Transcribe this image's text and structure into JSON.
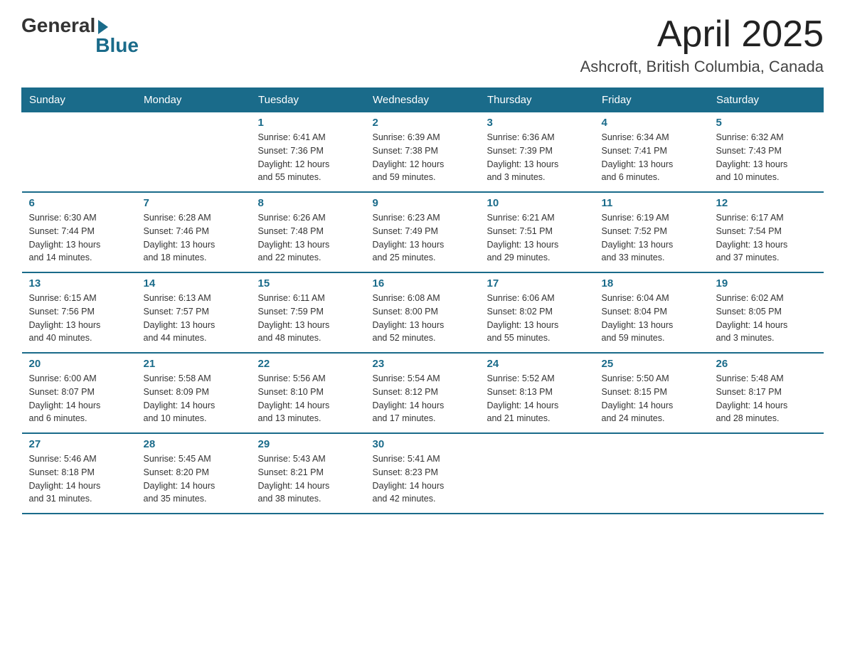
{
  "logo": {
    "general": "General",
    "blue": "Blue"
  },
  "header": {
    "month": "April 2025",
    "location": "Ashcroft, British Columbia, Canada"
  },
  "days_of_week": [
    "Sunday",
    "Monday",
    "Tuesday",
    "Wednesday",
    "Thursday",
    "Friday",
    "Saturday"
  ],
  "weeks": [
    [
      {
        "day": "",
        "info": ""
      },
      {
        "day": "",
        "info": ""
      },
      {
        "day": "1",
        "info": "Sunrise: 6:41 AM\nSunset: 7:36 PM\nDaylight: 12 hours\nand 55 minutes."
      },
      {
        "day": "2",
        "info": "Sunrise: 6:39 AM\nSunset: 7:38 PM\nDaylight: 12 hours\nand 59 minutes."
      },
      {
        "day": "3",
        "info": "Sunrise: 6:36 AM\nSunset: 7:39 PM\nDaylight: 13 hours\nand 3 minutes."
      },
      {
        "day": "4",
        "info": "Sunrise: 6:34 AM\nSunset: 7:41 PM\nDaylight: 13 hours\nand 6 minutes."
      },
      {
        "day": "5",
        "info": "Sunrise: 6:32 AM\nSunset: 7:43 PM\nDaylight: 13 hours\nand 10 minutes."
      }
    ],
    [
      {
        "day": "6",
        "info": "Sunrise: 6:30 AM\nSunset: 7:44 PM\nDaylight: 13 hours\nand 14 minutes."
      },
      {
        "day": "7",
        "info": "Sunrise: 6:28 AM\nSunset: 7:46 PM\nDaylight: 13 hours\nand 18 minutes."
      },
      {
        "day": "8",
        "info": "Sunrise: 6:26 AM\nSunset: 7:48 PM\nDaylight: 13 hours\nand 22 minutes."
      },
      {
        "day": "9",
        "info": "Sunrise: 6:23 AM\nSunset: 7:49 PM\nDaylight: 13 hours\nand 25 minutes."
      },
      {
        "day": "10",
        "info": "Sunrise: 6:21 AM\nSunset: 7:51 PM\nDaylight: 13 hours\nand 29 minutes."
      },
      {
        "day": "11",
        "info": "Sunrise: 6:19 AM\nSunset: 7:52 PM\nDaylight: 13 hours\nand 33 minutes."
      },
      {
        "day": "12",
        "info": "Sunrise: 6:17 AM\nSunset: 7:54 PM\nDaylight: 13 hours\nand 37 minutes."
      }
    ],
    [
      {
        "day": "13",
        "info": "Sunrise: 6:15 AM\nSunset: 7:56 PM\nDaylight: 13 hours\nand 40 minutes."
      },
      {
        "day": "14",
        "info": "Sunrise: 6:13 AM\nSunset: 7:57 PM\nDaylight: 13 hours\nand 44 minutes."
      },
      {
        "day": "15",
        "info": "Sunrise: 6:11 AM\nSunset: 7:59 PM\nDaylight: 13 hours\nand 48 minutes."
      },
      {
        "day": "16",
        "info": "Sunrise: 6:08 AM\nSunset: 8:00 PM\nDaylight: 13 hours\nand 52 minutes."
      },
      {
        "day": "17",
        "info": "Sunrise: 6:06 AM\nSunset: 8:02 PM\nDaylight: 13 hours\nand 55 minutes."
      },
      {
        "day": "18",
        "info": "Sunrise: 6:04 AM\nSunset: 8:04 PM\nDaylight: 13 hours\nand 59 minutes."
      },
      {
        "day": "19",
        "info": "Sunrise: 6:02 AM\nSunset: 8:05 PM\nDaylight: 14 hours\nand 3 minutes."
      }
    ],
    [
      {
        "day": "20",
        "info": "Sunrise: 6:00 AM\nSunset: 8:07 PM\nDaylight: 14 hours\nand 6 minutes."
      },
      {
        "day": "21",
        "info": "Sunrise: 5:58 AM\nSunset: 8:09 PM\nDaylight: 14 hours\nand 10 minutes."
      },
      {
        "day": "22",
        "info": "Sunrise: 5:56 AM\nSunset: 8:10 PM\nDaylight: 14 hours\nand 13 minutes."
      },
      {
        "day": "23",
        "info": "Sunrise: 5:54 AM\nSunset: 8:12 PM\nDaylight: 14 hours\nand 17 minutes."
      },
      {
        "day": "24",
        "info": "Sunrise: 5:52 AM\nSunset: 8:13 PM\nDaylight: 14 hours\nand 21 minutes."
      },
      {
        "day": "25",
        "info": "Sunrise: 5:50 AM\nSunset: 8:15 PM\nDaylight: 14 hours\nand 24 minutes."
      },
      {
        "day": "26",
        "info": "Sunrise: 5:48 AM\nSunset: 8:17 PM\nDaylight: 14 hours\nand 28 minutes."
      }
    ],
    [
      {
        "day": "27",
        "info": "Sunrise: 5:46 AM\nSunset: 8:18 PM\nDaylight: 14 hours\nand 31 minutes."
      },
      {
        "day": "28",
        "info": "Sunrise: 5:45 AM\nSunset: 8:20 PM\nDaylight: 14 hours\nand 35 minutes."
      },
      {
        "day": "29",
        "info": "Sunrise: 5:43 AM\nSunset: 8:21 PM\nDaylight: 14 hours\nand 38 minutes."
      },
      {
        "day": "30",
        "info": "Sunrise: 5:41 AM\nSunset: 8:23 PM\nDaylight: 14 hours\nand 42 minutes."
      },
      {
        "day": "",
        "info": ""
      },
      {
        "day": "",
        "info": ""
      },
      {
        "day": "",
        "info": ""
      }
    ]
  ]
}
